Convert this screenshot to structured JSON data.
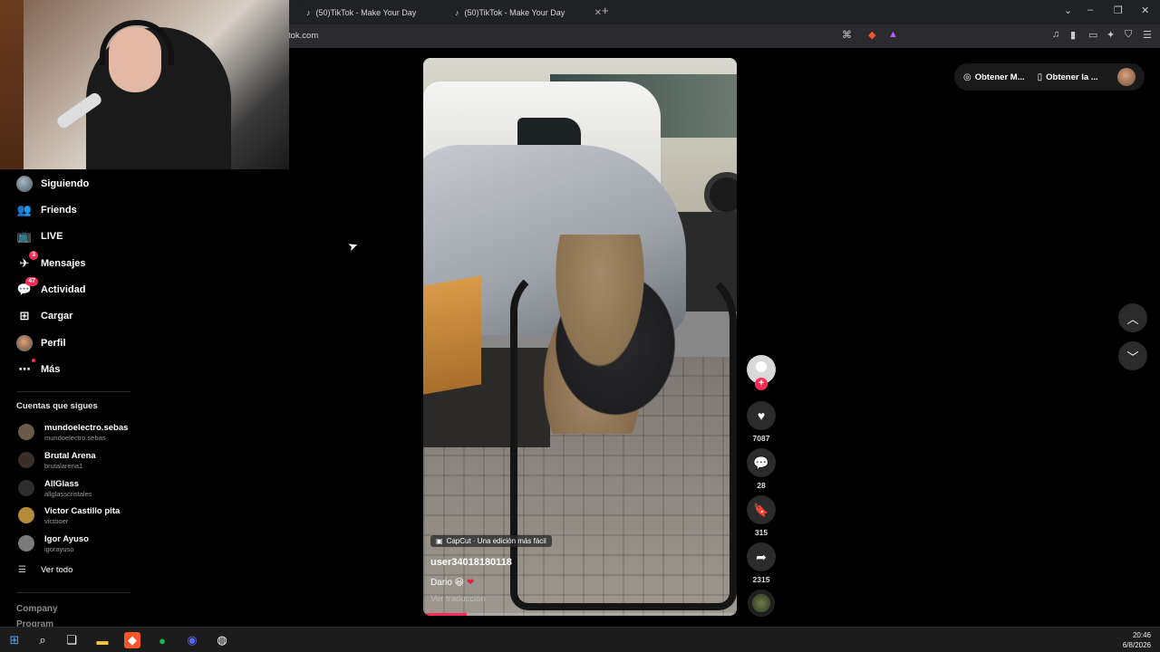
{
  "browser": {
    "tabs": [
      {
        "label": "(50)TikTok - Make Your Day"
      },
      {
        "label": "(50)TikTok - Make Your Day"
      }
    ],
    "new_tab": "+",
    "url": "tok.com"
  },
  "sidebar": {
    "nav": [
      {
        "label": "Siguiendo",
        "icon": "following-avatar"
      },
      {
        "label": "Friends",
        "icon": "friends-icon"
      },
      {
        "label": "LIVE",
        "icon": "live-icon"
      },
      {
        "label": "Mensajes",
        "icon": "messages-icon",
        "badge": "3"
      },
      {
        "label": "Actividad",
        "icon": "activity-icon",
        "badge": "47"
      },
      {
        "label": "Cargar",
        "icon": "upload-icon"
      },
      {
        "label": "Perfil",
        "icon": "profile-avatar"
      },
      {
        "label": "Más",
        "icon": "more-icon"
      }
    ],
    "following_heading": "Cuentas que sigues",
    "accounts": [
      {
        "name": "mundoelectro.sebas",
        "handle": "mundoelectro.sebas",
        "color": "#6b5a4a"
      },
      {
        "name": "Brutal Arena",
        "handle": "brutalarena1",
        "color": "#3a2e2a"
      },
      {
        "name": "AllGlass",
        "handle": "allglasscristales",
        "color": "#2d2d2d"
      },
      {
        "name": "Victor Castillo pita",
        "handle": "victooer",
        "color": "#b58a3a"
      },
      {
        "name": "Igor Ayuso",
        "handle": "igorayuso",
        "color": "#7a7a7a"
      }
    ],
    "see_all": "Ver todo",
    "footer": [
      "Company",
      "Program"
    ]
  },
  "video": {
    "capcut": "CapCut · Una edición más fácil",
    "username": "user34018180118",
    "description": "Dario 😃",
    "translate": "Ver traducción",
    "progress": 0.14
  },
  "actions": {
    "likes": "7087",
    "comments": "28",
    "saves": "315",
    "shares": "2315"
  },
  "topright": {
    "btn1": "Obtener M...",
    "btn2": "Obtener la ..."
  },
  "taskbar": {
    "time": "20:46",
    "date": "6/8/2026"
  },
  "colors": {
    "accent": "#fe2c55"
  }
}
